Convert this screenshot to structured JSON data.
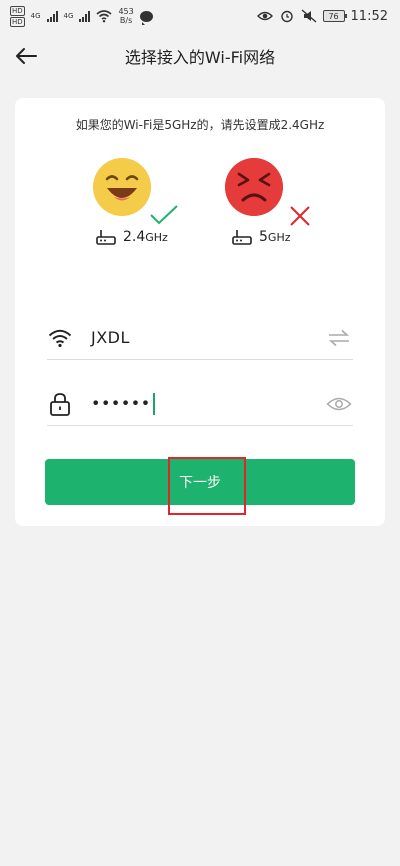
{
  "status_bar": {
    "hd1": "HD",
    "hd2": "HD",
    "net1": "4G",
    "net2": "4G",
    "speed_value": "453",
    "speed_unit": "B/s",
    "battery": "76",
    "time": "11:52"
  },
  "header": {
    "title": "选择接入的Wi-Fi网络"
  },
  "card": {
    "hint": "如果您的Wi-Fi是5GHz的，请先设置成2.4GHz",
    "good_band": {
      "num": "2.4",
      "unit": "GHz"
    },
    "bad_band": {
      "num": "5",
      "unit": "GHz"
    }
  },
  "form": {
    "ssid": "JXDL",
    "password_masked": "••••••"
  },
  "actions": {
    "next_label": "下一步"
  },
  "colors": {
    "accent": "#1db36e",
    "highlight": "#e0262b",
    "good_face": "#f4cc4a",
    "bad_face": "#e53b3b"
  }
}
